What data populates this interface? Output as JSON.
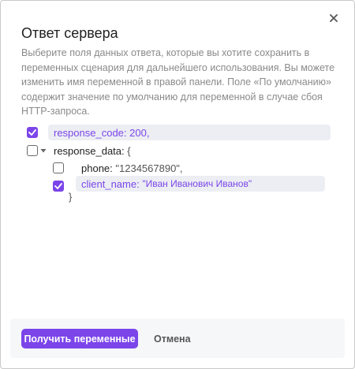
{
  "dialog": {
    "title": "Ответ сервера",
    "description": "Выберите поля данных ответа, которые вы хотите сохранить в переменных сценария для дальнейшего использования. Вы можете изменить имя переменной в правой панели. Поле «По умолчанию» содержит значение по умолчанию для переменной в случае сбоя HTTP-запроса.",
    "close_icon": "close-icon"
  },
  "tree": {
    "response_code": {
      "key": "response_code:",
      "value": "200,",
      "checked": true
    },
    "response_data": {
      "key": "response_data:",
      "open_brace": "{",
      "checked": false,
      "expanded": true
    },
    "phone": {
      "key": "phone:",
      "value": "\"1234567890\",",
      "checked": false
    },
    "client_name": {
      "key": "client_name:",
      "value": "\"Иван Иванович Иванов\"",
      "checked": true
    },
    "close_brace": "}"
  },
  "footer": {
    "primary_label": "Получить переменные",
    "cancel_label": "Отмена"
  },
  "colors": {
    "accent": "#7b45ea",
    "pill": "#eceef3"
  }
}
